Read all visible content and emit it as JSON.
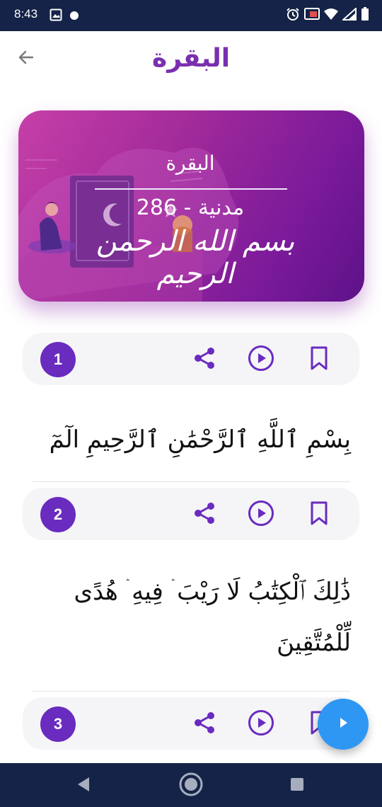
{
  "status_bar": {
    "time": "8:43"
  },
  "header": {
    "title": "البقرة"
  },
  "surah_card": {
    "name": "البقرة",
    "info": "مدنية - 286",
    "basmala": "بسم الله الرحمن الرحيم"
  },
  "ayahs": [
    {
      "number": "1",
      "text": "بِسْمِ ٱللَّهِ ٱلرَّحْمَٰنِ ٱلرَّحِيمِ الٓمٓ"
    },
    {
      "number": "2",
      "text": "ذَٰلِكَ ٱلْكِتَٰبُ لَا رَيْبَ ۛ فِيهِ ۛ هُدًى لِّلْمُتَّقِينَ"
    },
    {
      "number": "3"
    }
  ],
  "colors": {
    "accent_purple": "#6a2bbf",
    "title_purple": "#7a2fb0",
    "fab_blue": "#2e97f3",
    "system_bar": "#142347"
  },
  "icons": {
    "back": "arrow-back-icon",
    "share": "share-icon",
    "play": "play-circle-icon",
    "bookmark": "bookmark-icon",
    "fab": "play-icon"
  }
}
